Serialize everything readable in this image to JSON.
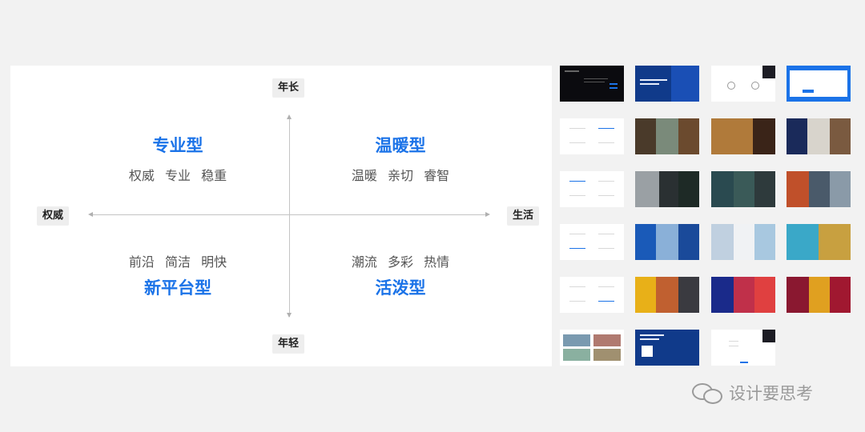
{
  "matrix": {
    "axes": {
      "top": "年长",
      "bottom": "年轻",
      "left": "权威",
      "right": "生活"
    },
    "quadrants": {
      "top_left": {
        "title": "专业型",
        "keywords": "权威 专业 稳重"
      },
      "top_right": {
        "title": "温暖型",
        "keywords": "温暖 亲切 睿智"
      },
      "bottom_left": {
        "title": "新平台型",
        "keywords": "前沿 简洁 明快"
      },
      "bottom_right": {
        "title": "活泼型",
        "keywords": "潮流 多彩 热情"
      }
    },
    "accent_color": "#1b73e8"
  },
  "watermark": {
    "text": "设计要思考",
    "icon": "wechat-icon"
  }
}
